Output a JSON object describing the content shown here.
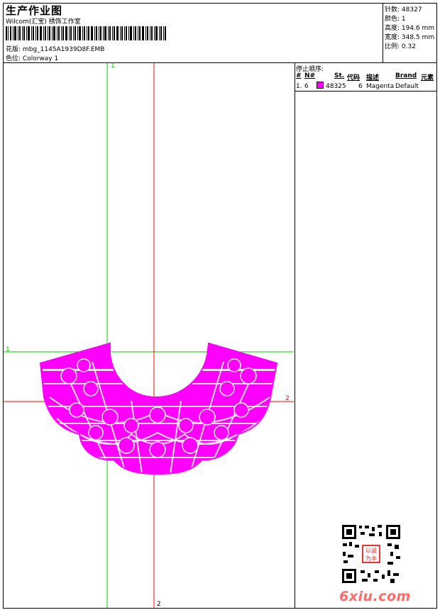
{
  "header": {
    "title": "生产作业图",
    "company": "Wilcom(汇宝) 绣饰工作室",
    "design_label": "花版:",
    "design_file": "mbg_1145A1939D8F.EMB",
    "colorway_label": "色位:",
    "colorway": "Colorway 1"
  },
  "stats": [
    {
      "label": "针数:",
      "value": "48327"
    },
    {
      "label": "颜色:",
      "value": "1"
    },
    {
      "label": "高度:",
      "value": "194.6 mm"
    },
    {
      "label": "宽度:",
      "value": "348.5 mm"
    },
    {
      "label": "比例:",
      "value": "0.32"
    }
  ],
  "stop_sequence": {
    "title": "停止顺序:",
    "columns": [
      "#",
      "N#",
      "St.",
      "代码",
      "描述",
      "Brand",
      "元素"
    ],
    "rows": [
      {
        "index": "1.",
        "n": "6",
        "stitches": "48325",
        "code": "6",
        "description": "Magenta",
        "brand": "Default",
        "color": "#ff00ff"
      }
    ]
  },
  "canvas": {
    "green_label_top": "1",
    "green_label_left": "1",
    "red_label_right": "2",
    "red_label_bottom": "2",
    "green_color": "#00cc00",
    "red_color": "#ff0000",
    "thread_color": "#ff00ff"
  },
  "watermark": {
    "site": "6xiu.com",
    "seal": "以诚为本"
  }
}
